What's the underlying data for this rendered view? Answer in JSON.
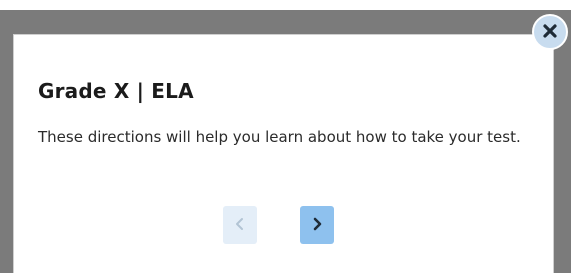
{
  "dialog": {
    "title": "Grade X | ELA",
    "body": "These directions will help you learn about how to take your test."
  },
  "controls": {
    "close_icon": "close-icon",
    "prev_icon": "chevron-left-icon",
    "next_icon": "chevron-right-icon",
    "prev_enabled": false,
    "next_enabled": true
  },
  "colors": {
    "overlay": "#7b7b7b",
    "close_bg": "#c8dcef",
    "close_glyph": "#1e2b37",
    "prev_bg": "#e4eef8",
    "prev_glyph": "#b2c4d4",
    "next_bg": "#8ec1ee",
    "next_glyph": "#1e2b37"
  }
}
